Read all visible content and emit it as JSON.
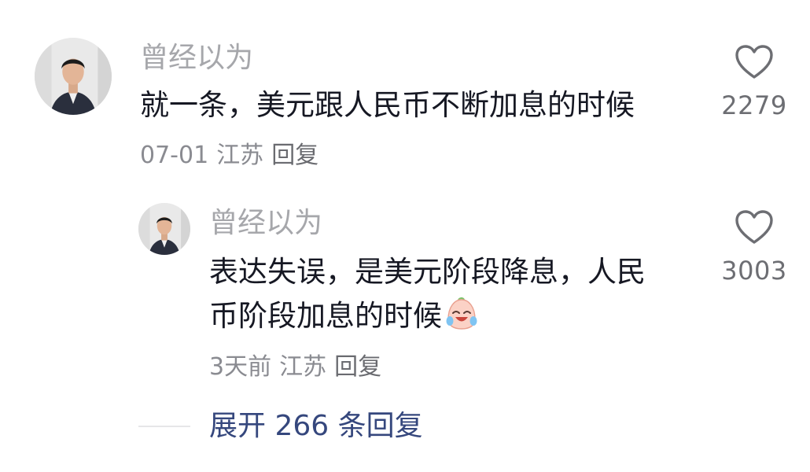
{
  "comment": {
    "username": "曾经以为",
    "text": "就一条，美元跟人民币不断加息的时候",
    "date": "07-01",
    "location": "江苏",
    "reply_label": "回复",
    "like_count": "2279",
    "avatar_icon": "profile-photo",
    "like_icon": "heart-outline-icon"
  },
  "reply": {
    "username": "曾经以为",
    "text_line1": "表达失误，是美元阶段降息，人民",
    "text_line2": "币阶段加息的时候",
    "emoji": "crying-laughing-emoji",
    "date": "3天前",
    "location": "江苏",
    "reply_label": "回复",
    "like_count": "3003",
    "avatar_icon": "profile-photo",
    "like_icon": "heart-outline-icon"
  },
  "expand": {
    "label": "展开 266 条回复"
  },
  "colors": {
    "username": "#a6a7ab",
    "text": "#161823",
    "meta": "#8a8b91",
    "expand": "#35477d",
    "heart_stroke": "#6d6e73"
  }
}
